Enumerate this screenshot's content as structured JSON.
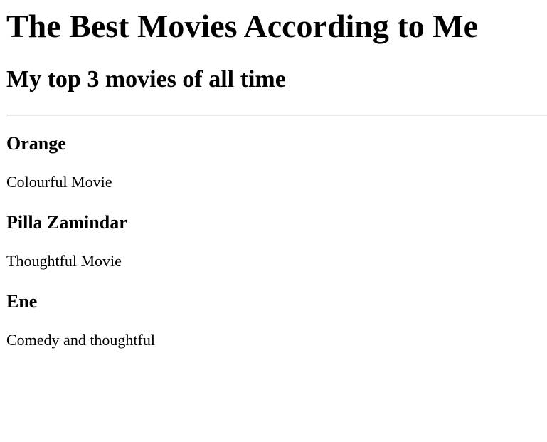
{
  "header": {
    "title": "The Best Movies According to Me",
    "subtitle": "My top 3 movies of all time"
  },
  "movies": [
    {
      "title": "Orange",
      "description": "Colourful Movie"
    },
    {
      "title": "Pilla Zamindar",
      "description": "Thoughtful Movie"
    },
    {
      "title": "Ene",
      "description": "Comedy and thoughtful"
    }
  ]
}
